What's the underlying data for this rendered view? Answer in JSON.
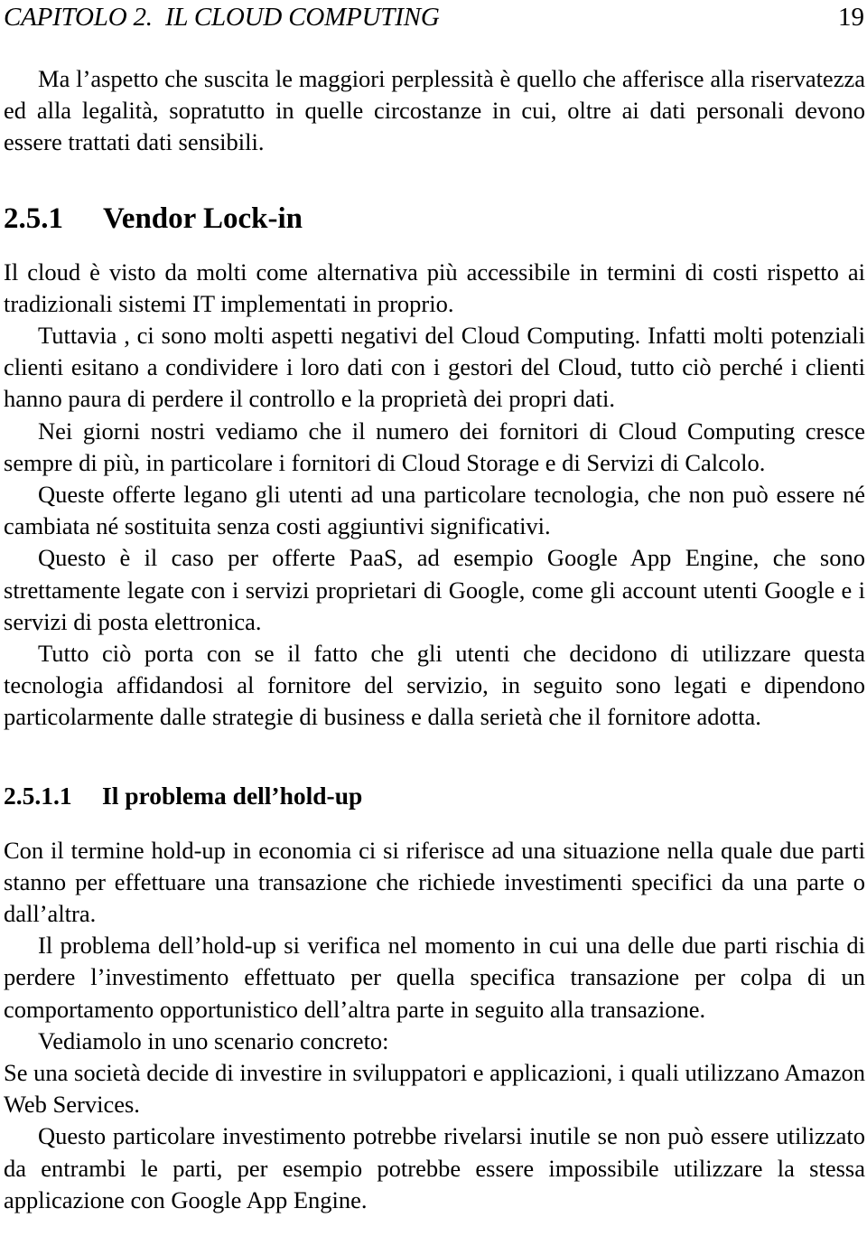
{
  "document": {
    "language": "it",
    "running_header": {
      "chapter_title": "CAPITOLO 2.  IL CLOUD COMPUTING",
      "page_number": "19"
    },
    "text_color": "#000000",
    "background_color": "#ffffff"
  },
  "content": {
    "intro_paragraph": "Ma l’aspetto che suscita le maggiori perplessità è quello che afferisce alla riservatezza ed alla legalità, sopratutto in quelle circostanze in cui, oltre ai dati personali devono essere trattati dati sensibili.",
    "section": {
      "number": "2.5.1",
      "title": "Vendor Lock-in",
      "paragraphs": [
        "Il cloud è visto da molti come alternativa più accessibile in termini di costi rispetto ai tradizionali sistemi IT implementati in proprio.",
        "Tuttavia , ci sono molti aspetti negativi del Cloud Computing. Infatti molti potenziali clienti esitano a condividere i loro dati con i gestori del Cloud, tutto ciò perché i clienti hanno paura di perdere il controllo e la proprietà dei propri dati.",
        "Nei giorni nostri vediamo che il numero dei fornitori di Cloud Computing cresce sempre di più, in particolare i fornitori di Cloud Storage e di Servizi di Calcolo.",
        "Queste offerte legano gli utenti ad una particolare tecnologia, che non può essere né cambiata né sostituita senza costi aggiuntivi significativi.",
        "Questo è il caso per offerte PaaS, ad esempio Google App Engine, che sono strettamente legate con i servizi proprietari di Google, come gli account utenti Google e i servizi di posta elettronica.",
        "Tutto ciò porta con se il fatto che gli utenti che decidono di utilizzare questa tecnologia affidandosi al fornitore del servizio, in seguito sono legati e dipendono particolarmente dalle strategie di business e dalla serietà che il fornitore adotta."
      ]
    },
    "subsection": {
      "number": "2.5.1.1",
      "title": "Il problema dell’hold-up",
      "paragraphs": [
        "Con il termine hold-up in economia ci si riferisce ad una situazione nella quale due parti stanno per effettuare una transazione che richiede investimenti specifici da una parte o dall’altra.",
        "Il problema dell’hold-up si verifica nel momento in cui una delle due parti rischia di perdere l’investimento effettuato per quella specifica transazione per col­pa di un comportamento opportunistico dell’altra parte in seguito alla transazione.",
        "Vediamolo in uno scenario concreto:",
        "Se una società decide di investire in sviluppatori e applicazioni, i quali utiliz­zano Amazon Web Services.",
        "Questo particolare investimento potrebbe rivelarsi inutile se non può essere utilizzato da entrambi le parti, per esempio potrebbe essere impossibile utilizzare la stessa applicazione con Google App Engine."
      ]
    }
  }
}
